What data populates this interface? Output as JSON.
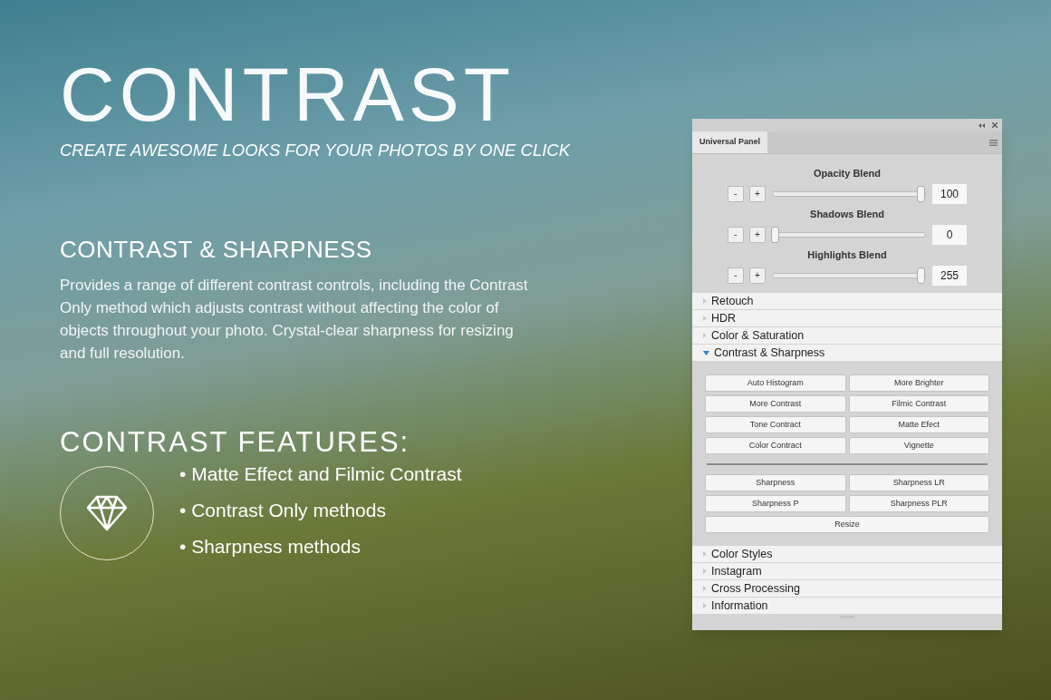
{
  "hero": {
    "title": "CONTRAST",
    "subtitle": "CREATE AWESOME LOOKS FOR YOUR PHOTOS BY ONE CLICK"
  },
  "section": {
    "heading": "CONTRAST & SHARPNESS",
    "description": "Provides a range of different contrast controls, including the Contrast Only method which adjusts contrast without affecting the color of objects throughout your photo. Crystal-clear sharpness for resizing and full resolution."
  },
  "features": {
    "heading": "CONTRAST FEATURES:",
    "items": [
      "• Matte Effect and Filmic Contrast",
      "• Contrast Only methods",
      "• Sharpness methods"
    ]
  },
  "panel": {
    "title": "Universal Panel",
    "sliders": [
      {
        "label": "Opacity Blend",
        "minus": "-",
        "plus": "+",
        "level": 1,
        "value": "100"
      },
      {
        "label": "Shadows Blend",
        "minus": "-",
        "plus": "+",
        "level": 0,
        "value": "0"
      },
      {
        "label": "Highlights Blend",
        "minus": "-",
        "plus": "+",
        "level": 1,
        "value": "255"
      }
    ],
    "sections": [
      {
        "label": "Retouch",
        "expanded": false
      },
      {
        "label": "HDR",
        "expanded": false
      },
      {
        "label": "Color & Saturation",
        "expanded": false
      },
      {
        "label": "Contrast & Sharpness",
        "expanded": true,
        "button_groups": [
          {
            "buttons": [
              "Auto Histogram",
              "More Brighter",
              "More Contrast",
              "Filmic Contrast",
              "Tone Contract",
              "Matte Efect",
              "Color Contract",
              "Vignette"
            ]
          },
          {
            "buttons": [
              "Sharpness",
              "Sharpness LR",
              "Sharpness P",
              "Sharpness PLR",
              "Resize"
            ]
          }
        ]
      },
      {
        "label": "Color Styles",
        "expanded": false
      },
      {
        "label": "Instagram",
        "expanded": false
      },
      {
        "label": "Cross Processing",
        "expanded": false
      },
      {
        "label": "Information",
        "expanded": false
      }
    ]
  }
}
